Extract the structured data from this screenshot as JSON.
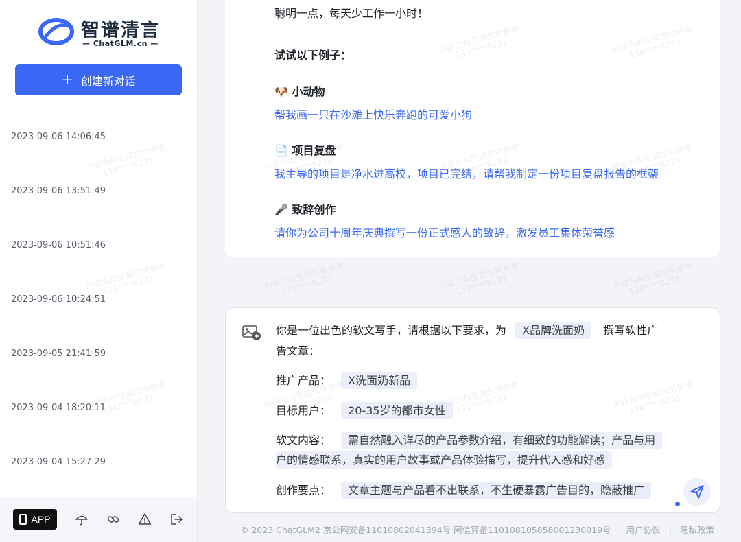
{
  "brand": {
    "name": "智谱清言",
    "domain": "— ChatGLM.cn —",
    "accent": "#3a68f5"
  },
  "sidebar": {
    "new_chat_label": "创建新对话",
    "history": [
      "2023-09-06 14:06:45",
      "2023-09-06 13:51:49",
      "2023-09-06 10:51:46",
      "2023-09-06 10:24:51",
      "2023-09-05 21:41:59",
      "2023-09-04 18:20:11",
      "2023-09-04 15:27:29"
    ],
    "footer": {
      "app_label": "APP",
      "icons": [
        "umbrella-icon",
        "link-icon",
        "warning-icon",
        "logout-icon"
      ]
    }
  },
  "intro": {
    "line1": "聪明一点，每天少工作一小时！",
    "examples_heading": "试试以下例子：",
    "examples": [
      {
        "emoji": "🐶",
        "title": "小动物",
        "prompt": "帮我画一只在沙滩上快乐奔跑的可爱小狗"
      },
      {
        "emoji": "📄",
        "title": "项目复盘",
        "prompt": "我主导的项目是净水进高校，项目已完结，请帮我制定一份项目复盘报告的框架"
      },
      {
        "emoji": "🎤",
        "title": "致辞创作",
        "prompt": "请你为公司十周年庆典撰写一份正式感人的致辞，激发员工集体荣誉感"
      }
    ]
  },
  "composer": {
    "line1_prefix": "你是一位出色的软文写手，请根据以下要求，为",
    "brand_chip": "X品牌洗面奶",
    "line1_suffix": "撰写软性广",
    "line2": "告文章：",
    "product_label": "推广产品：",
    "product_value": "X洗面奶新品",
    "audience_label": "目标用户：",
    "audience_value": "20-35岁的都市女性",
    "content_label": "软文内容：",
    "content_value_1": "需自然融入详尽的产品参数介绍，有细致的功能解读；产品与用",
    "content_value_2": "户的情感联系，真实的用户故事或产品体验描写，提升代入感和好感",
    "points_label": "创作要点：",
    "points_value": "文章主题与产品看不出联系，不生硬暴露广告目的，隐蔽推广"
  },
  "footer": {
    "copyright": "© 2023 ChatGLM2 京公网安备11010802041394号 网信算备110108105858001230019号",
    "agreement": "用户协议",
    "separator": "|",
    "privacy": "隐私政策"
  },
  "watermark": {
    "line1": "内容为AI生成仅供参考",
    "line2": "134****8231"
  }
}
